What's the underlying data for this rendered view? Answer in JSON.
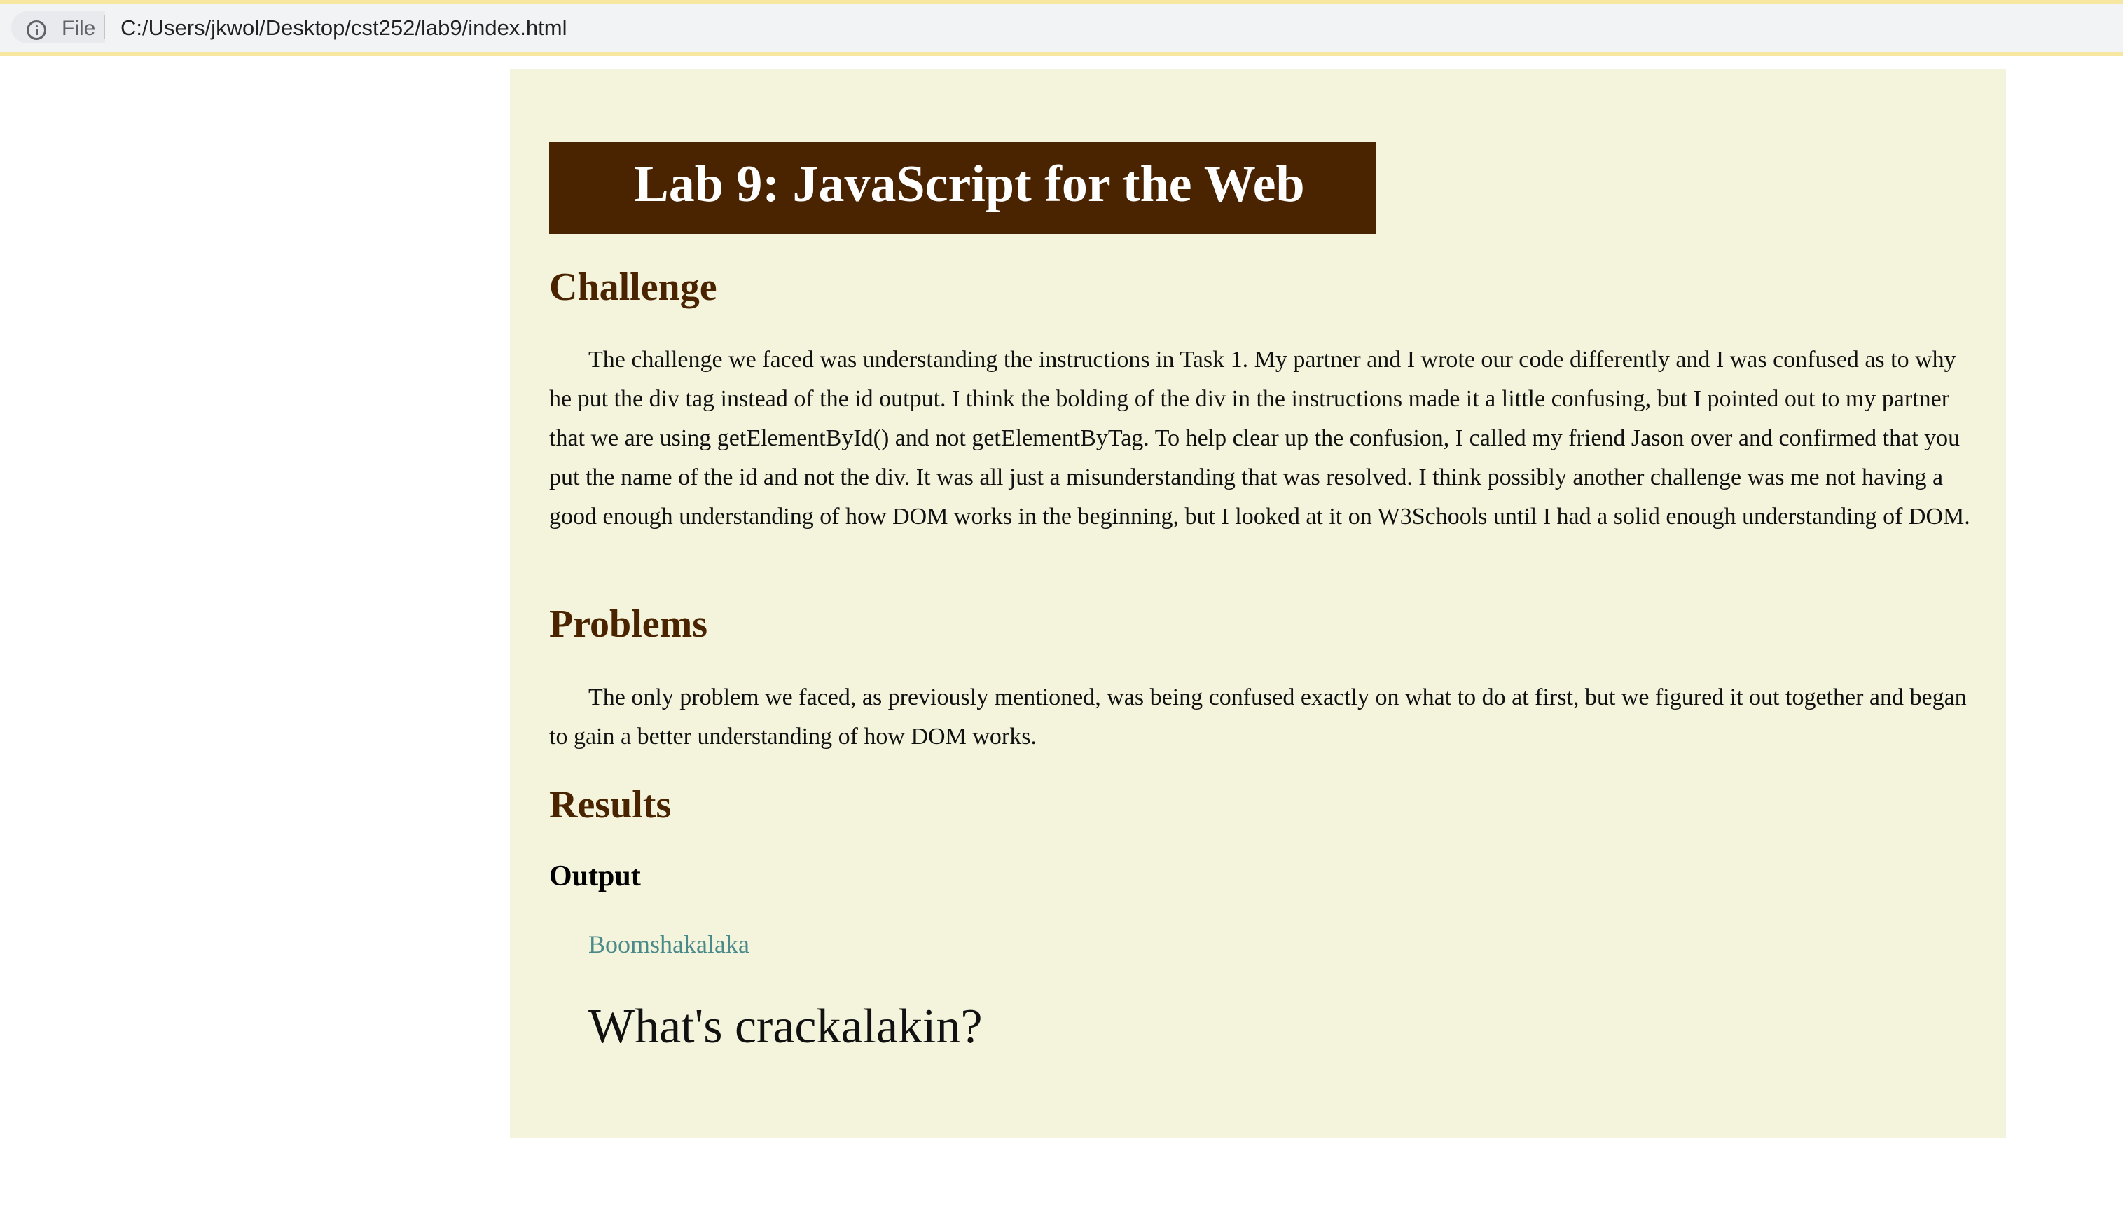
{
  "browser": {
    "file_label": "File",
    "url": "C:/Users/jkwol/Desktop/cst252/lab9/index.html"
  },
  "page": {
    "title": "Lab 9: JavaScript for the Web",
    "sections": {
      "challenge": {
        "heading": "Challenge",
        "text": "The challenge we faced was understanding the instructions in Task 1. My partner and I wrote our code differently and I was confused as to why he put the div tag instead of the id output. I think the bolding of the div in the instructions made it a little confusing, but I pointed out to my partner that we are using getElementById() and not getElementByTag. To help clear up the confusion, I called my friend Jason over and confirmed that you put the name of the id and not the div. It was all just a misunderstanding that was resolved. I think possibly another challenge was me not having a good enough understanding of how DOM works in the beginning, but I looked at it on W3Schools until I had a solid enough understanding of DOM."
      },
      "problems": {
        "heading": "Problems",
        "text": "The only problem we faced, as previously mentioned, was being confused exactly on what to do at first, but we figured it out together and began to gain a better understanding of how DOM works."
      },
      "results": {
        "heading": "Results",
        "output_heading": "Output",
        "output_link": "Boomshakalaka",
        "output_text": "What's crackalakin?"
      }
    }
  },
  "colors": {
    "content_bg": "#f4f4dc",
    "title_bg": "#4a2400",
    "heading": "#4a2400",
    "link": "#4a8a8a",
    "address_border": "#f8e7a0"
  },
  "icons": {
    "site_info": "info-icon"
  }
}
